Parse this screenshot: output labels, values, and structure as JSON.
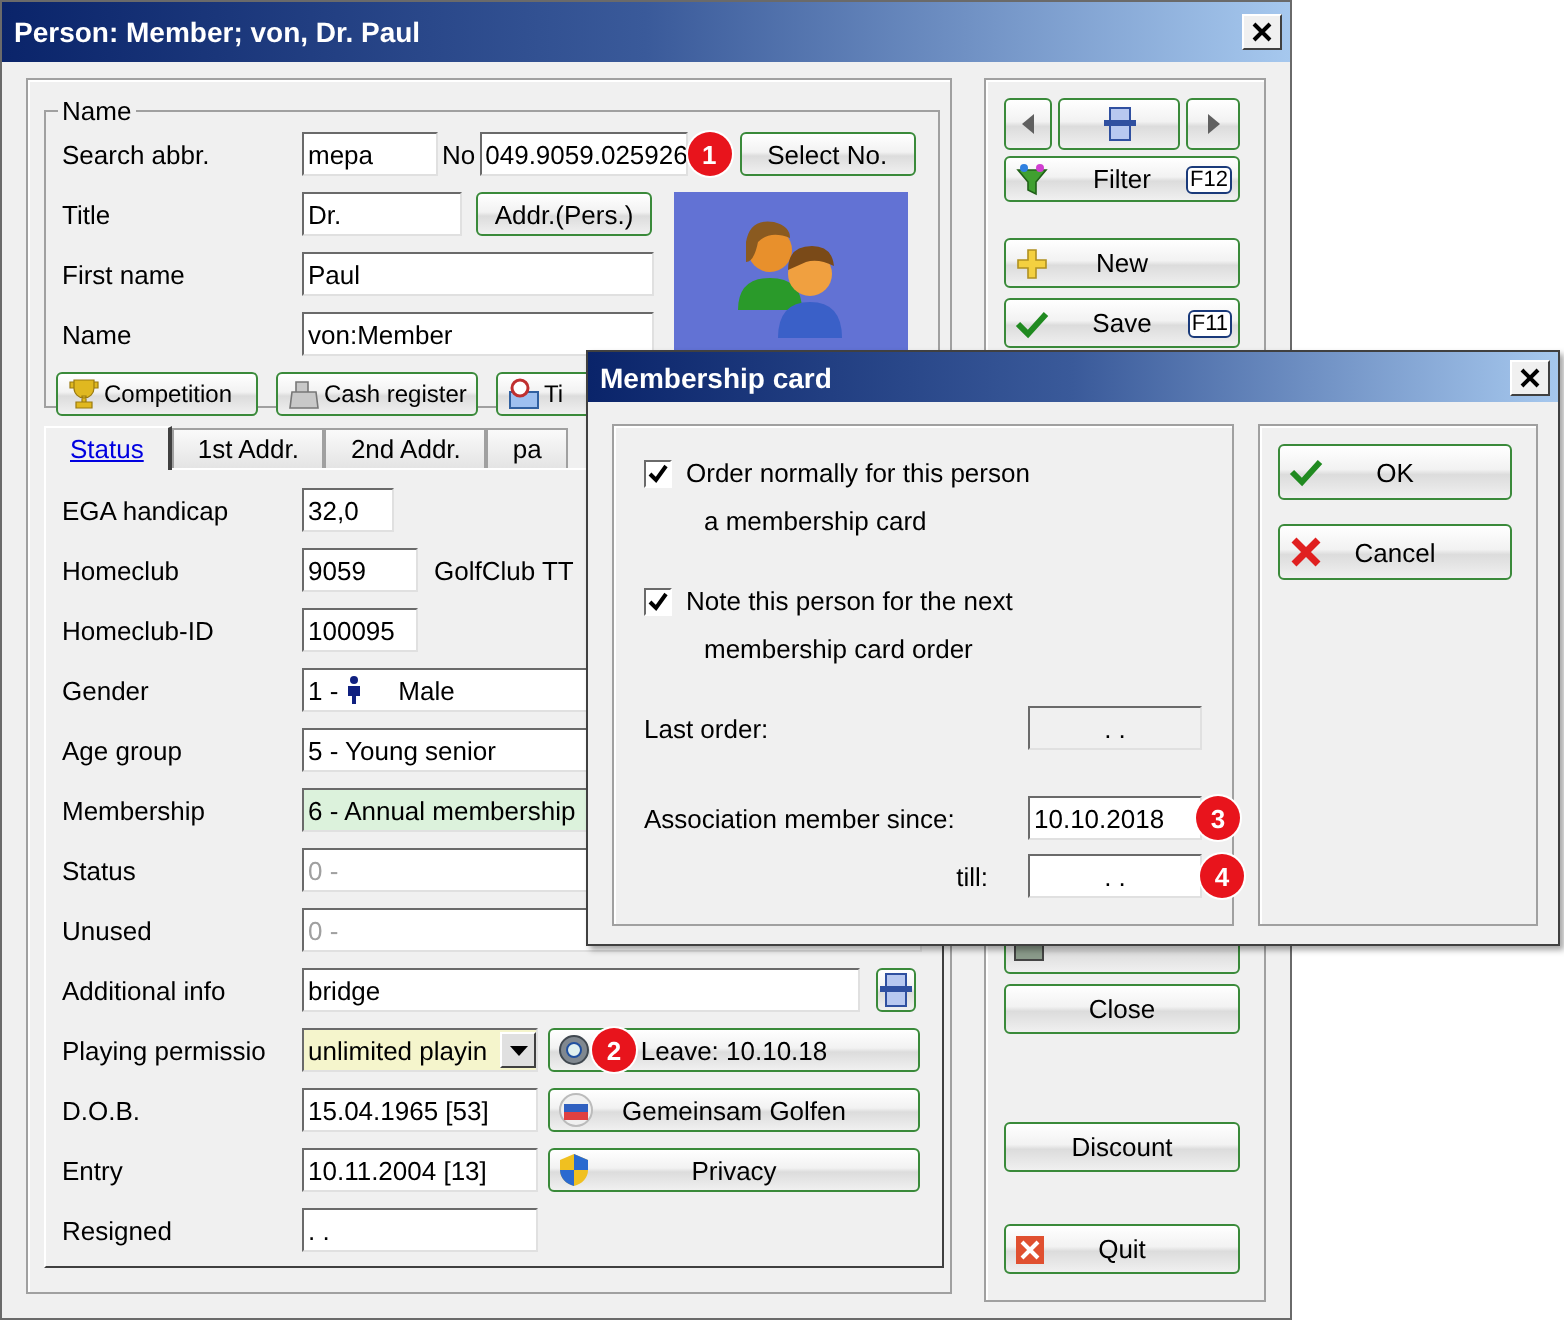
{
  "window": {
    "title": "Person: Member; von, Dr. Paul"
  },
  "name_group": {
    "legend": "Name",
    "search_abbr": {
      "label": "Search abbr.",
      "value": "mepa"
    },
    "number": {
      "label": "No",
      "value": "049.9059.025926",
      "badge": "1"
    },
    "select_no_button": "Select No.",
    "title": {
      "label": "Title",
      "value": "Dr."
    },
    "addr_button": "Addr.(Pers.)",
    "first_name": {
      "label": "First name",
      "value": "Paul"
    },
    "name": {
      "label": "Name",
      "value": "von:Member"
    },
    "buttons": [
      {
        "label": "Competition"
      },
      {
        "label": "Cash register"
      },
      {
        "label": "Ti"
      }
    ]
  },
  "tabs": [
    {
      "label": "Status",
      "selected": true
    },
    {
      "label": "1st Addr.",
      "selected": false
    },
    {
      "label": "2nd Addr.",
      "selected": false
    },
    {
      "label": "pa",
      "selected": false
    }
  ],
  "status_fields": [
    {
      "label": "EGA handicap",
      "kind": "short",
      "value": "32,0",
      "disabled": false,
      "color": "#ffffff"
    },
    {
      "label": "Homeclub",
      "kind": "code",
      "value": "9059",
      "note": "GolfClub TT",
      "disabled": false,
      "color": "#ffffff"
    },
    {
      "label": "Homeclub-ID",
      "kind": "code",
      "value": "100095",
      "disabled": false,
      "color": "#ffffff"
    },
    {
      "label": "Gender",
      "kind": "combo",
      "code": "1 -",
      "text": "Male",
      "disabled": false,
      "color": "#ffffff"
    },
    {
      "label": "Age group",
      "kind": "combo",
      "value": "5 - Young senior",
      "disabled": false,
      "color": "#ffffff"
    },
    {
      "label": "Membership",
      "kind": "combo",
      "value": "6 - Annual membership",
      "disabled": false,
      "color": "#dcf2dc"
    },
    {
      "label": "Status",
      "kind": "combo",
      "value": "0 -",
      "disabled": true,
      "color": "#ffffff"
    },
    {
      "label": "Unused",
      "kind": "combo",
      "value": "0 -",
      "disabled": true,
      "color": "#ffffff"
    },
    {
      "label": "Additional info",
      "kind": "memo",
      "value": "bridge",
      "disabled": false,
      "color": "#ffffff"
    },
    {
      "label": "Playing permissio",
      "kind": "select",
      "value": "unlimited playin",
      "disabled": false,
      "color": "#f5f5cc",
      "action": {
        "label": "Leave: 10.10.18",
        "badge": "2"
      }
    },
    {
      "label": "D.O.B.",
      "kind": "date",
      "value": "15.04.1965  [53]",
      "disabled": false,
      "color": "#ffffff",
      "action": {
        "label": "Gemeinsam Golfen"
      }
    },
    {
      "label": "Entry",
      "kind": "date",
      "value": "10.11.2004  [13]",
      "disabled": false,
      "color": "#ffffff",
      "action": {
        "label": "Privacy"
      }
    },
    {
      "label": "Resigned",
      "kind": "date",
      "value": ". .",
      "disabled": false,
      "color": "#ffffff"
    }
  ],
  "side_buttons": [
    [
      {
        "label": "Filter",
        "key": "F12"
      }
    ],
    [
      {
        "label": "New"
      },
      {
        "label": "Save",
        "key": "F11"
      }
    ],
    [
      {
        "kind": "covered"
      },
      {
        "label": "Close"
      }
    ],
    [
      {
        "label": "Discount"
      }
    ],
    [
      {
        "label": "Quit"
      }
    ]
  ],
  "dialog": {
    "title": "Membership card",
    "options": [
      {
        "label": "Order normally for this person",
        "label_2": "a membership card",
        "checked": true
      },
      {
        "label": "Note this person for the next",
        "label_2": "membership card order",
        "checked": true
      }
    ],
    "last_order": {
      "label": "Last order:",
      "value": ". ."
    },
    "member_since": {
      "label": "Association member since:",
      "value": "10.10.2018",
      "badge": "3"
    },
    "till": {
      "label": "till:",
      "value": ". .",
      "badge": "4"
    },
    "buttons": [
      {
        "label": "OK"
      },
      {
        "label": "Cancel"
      }
    ]
  }
}
